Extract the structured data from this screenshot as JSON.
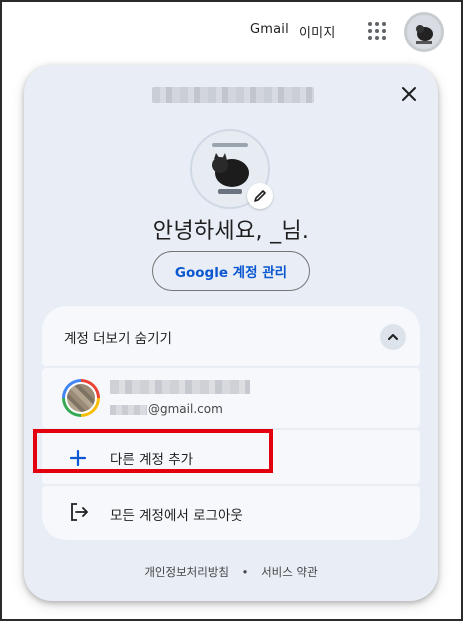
{
  "topbar": {
    "gmail_label": "Gmail",
    "images_label": "이미지",
    "apps_icon": "apps-grid-icon",
    "avatar_icon": "profile-avatar"
  },
  "card": {
    "close_icon": "close-icon",
    "greeting": "안녕하세요, _님.",
    "manage_button_label": "Google 계정 관리",
    "edit_icon": "pencil-icon"
  },
  "accounts": {
    "toggle_label": "계정 더보기 숨기기",
    "toggle_icon": "chevron-up-icon",
    "account_email_suffix": "@gmail.com",
    "add_account_label": "다른 계정 추가",
    "signout_label": "모든 계정에서 로그아웃"
  },
  "footer": {
    "privacy_label": "개인정보처리방침",
    "separator": "•",
    "terms_label": "서비스 약관"
  },
  "colors": {
    "card_bg": "#e8edf6",
    "row_bg": "#f6f8fc",
    "accent": "#0b57d0",
    "highlight": "#e3000f"
  }
}
